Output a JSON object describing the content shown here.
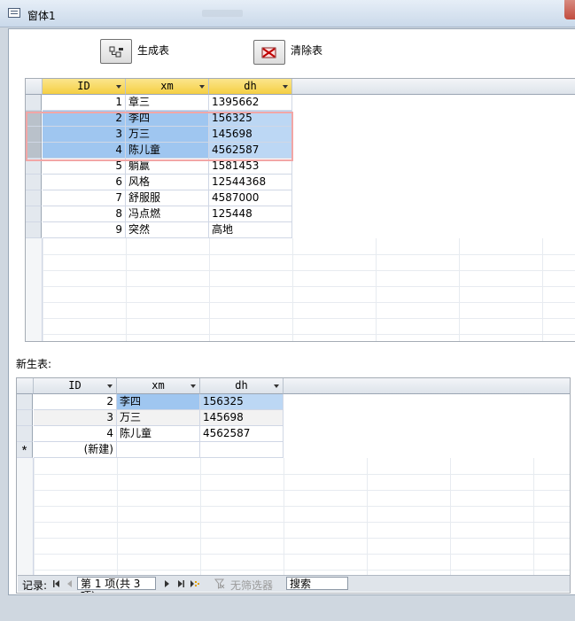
{
  "window": {
    "title": "窗体1"
  },
  "toolbar": {
    "generate_label": "生成表",
    "clear_label": "清除表"
  },
  "colors": {
    "header_yellow": "#f5cf43",
    "selection": "#bcd7f4",
    "selection_border": "#f2a6a6"
  },
  "grid1": {
    "columns": [
      "ID",
      "xm",
      "dh"
    ],
    "rows": [
      {
        "id": "1",
        "xm": "章三",
        "dh": "1395662",
        "selected": false
      },
      {
        "id": "2",
        "xm": "李四",
        "dh": "156325",
        "selected": true
      },
      {
        "id": "3",
        "xm": "万三",
        "dh": "145698",
        "selected": true
      },
      {
        "id": "4",
        "xm": "陈儿童",
        "dh": "4562587",
        "selected": true
      },
      {
        "id": "5",
        "xm": "躺赢",
        "dh": "1581453",
        "selected": false
      },
      {
        "id": "6",
        "xm": "风格",
        "dh": "12544368",
        "selected": false
      },
      {
        "id": "7",
        "xm": "舒服服",
        "dh": "4587000",
        "selected": false
      },
      {
        "id": "8",
        "xm": "冯点燃",
        "dh": "125448",
        "selected": false
      },
      {
        "id": "9",
        "xm": "突然",
        "dh": "高地",
        "selected": false
      }
    ]
  },
  "new_table_label": "新生表:",
  "grid2": {
    "columns": [
      "ID",
      "xm",
      "dh"
    ],
    "rows": [
      {
        "id": "2",
        "xm": "李四",
        "dh": "156325"
      },
      {
        "id": "3",
        "xm": "万三",
        "dh": "145698"
      },
      {
        "id": "4",
        "xm": "陈儿童",
        "dh": "4562587"
      }
    ],
    "new_row_marker": "*",
    "new_row_label": "(新建)"
  },
  "navigation": {
    "record_label": "记录:",
    "position": "第 1 项(共 3 项)",
    "filter_label": "无筛选器",
    "search_label": "搜索"
  },
  "icons": [
    "form-icon",
    "generate-table-icon",
    "clear-table-icon",
    "first-record-icon",
    "prev-record-icon",
    "next-record-icon",
    "last-record-icon",
    "new-record-icon",
    "filter-icon"
  ]
}
